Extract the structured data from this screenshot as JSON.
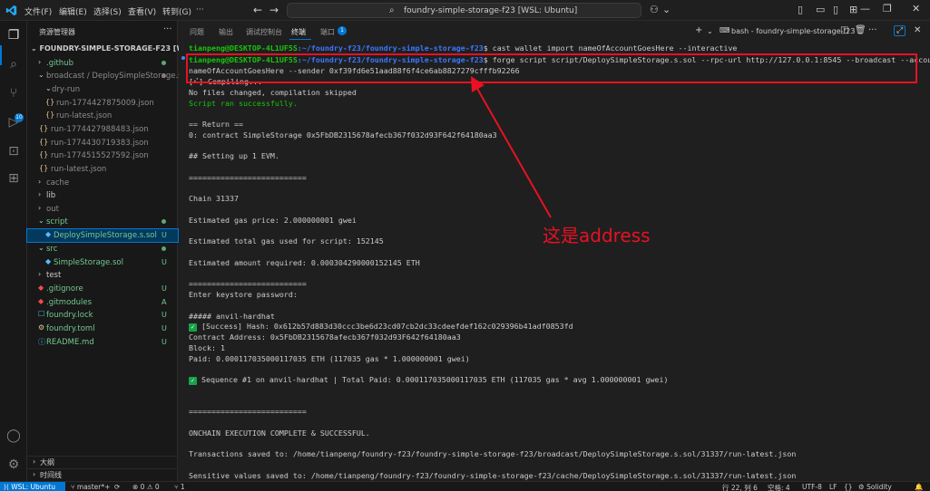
{
  "titlebar": {
    "menu": [
      "文件(F)",
      "编辑(E)",
      "选择(S)",
      "查看(V)",
      "转到(G)"
    ],
    "search_text": "foundry-simple-storage-f23 [WSL: Ubuntu]"
  },
  "sidebar": {
    "header": "资源管理器",
    "root": "FOUNDRY-SIMPLE-STORAGE-F23 [WSL: ...",
    "items": [
      {
        "label": ".github",
        "status": "dot"
      },
      {
        "label": "broadcast / DeploySimpleStorage.s...",
        "status": "dot"
      },
      {
        "label": "dry-run",
        "status": ""
      },
      {
        "label": "run-1774427875009.json",
        "status": ""
      },
      {
        "label": "run-latest.json",
        "status": ""
      },
      {
        "label": "run-1774427988483.json",
        "status": ""
      },
      {
        "label": "run-1774430719383.json",
        "status": ""
      },
      {
        "label": "run-1774515527592.json",
        "status": ""
      },
      {
        "label": "run-latest.json",
        "status": ""
      },
      {
        "label": "cache",
        "status": ""
      },
      {
        "label": "lib",
        "status": ""
      },
      {
        "label": "out",
        "status": ""
      },
      {
        "label": "script",
        "status": "dot"
      },
      {
        "label": "DeploySimpleStorage.s.sol",
        "status": "U"
      },
      {
        "label": "src",
        "status": "dot"
      },
      {
        "label": "SimpleStorage.sol",
        "status": "U"
      },
      {
        "label": "test",
        "status": ""
      },
      {
        "label": ".gitignore",
        "status": "U"
      },
      {
        "label": ".gitmodules",
        "status": "A"
      },
      {
        "label": "foundry.lock",
        "status": "U"
      },
      {
        "label": "foundry.toml",
        "status": "U"
      },
      {
        "label": "README.md",
        "status": "U"
      }
    ],
    "outline": "大纲",
    "timeline": "时间线"
  },
  "panel": {
    "tabs": [
      "问题",
      "输出",
      "调试控制台",
      "终端",
      "端口"
    ],
    "ports_badge": "1",
    "terminal_name": "bash - foundry-simple-storage-f23"
  },
  "terminal": {
    "prompt_user": "tianpeng@DESKTOP-4L1UF5S",
    "prompt_path": ":~/foundry-f23/foundry-simple-storage-f23",
    "cmd1": "$ cast wallet import nameOfAccountGoesHere --interactive",
    "cmd2": "$ forge script script/DeploySimpleStorage.s.sol --rpc-url http://127.0.0.1:8545 --broadcast --account",
    "cmd2_cont": "nameOfAccountGoesHere --sender 0xf39fd6e51aad88f6f4ce6ab8827279cfffb92266",
    "lines": [
      "[⠊] Compiling...",
      "No files changed, compilation skipped",
      "Script ran successfully.",
      "",
      "== Return ==",
      "0: contract SimpleStorage 0x5FbDB2315678afecb367f032d93F642f64180aa3",
      "",
      "## Setting up 1 EVM.",
      "",
      "==========================",
      "",
      "Chain 31337",
      "",
      "Estimated gas price: 2.000000001 gwei",
      "",
      "Estimated total gas used for script: 152145",
      "",
      "Estimated amount required: 0.000304290000152145 ETH",
      "",
      "==========================",
      "Enter keystore password:",
      "",
      "##### anvil-hardhat",
      " [Success] Hash: 0x612b57d883d30ccc3be6d23cd07cb2dc33cdeefdef162c029396b41adf0853fd",
      "Contract Address: 0x5FbDB2315678afecb367f032d93F642f64180aa3",
      "Block: 1",
      "Paid: 0.000117035000117035 ETH (117035 gas * 1.000000001 gwei)",
      "",
      " Sequence #1 on anvil-hardhat | Total Paid: 0.000117035000117035 ETH (117035 gas * avg 1.000000001 gwei)",
      "",
      "",
      "==========================",
      "",
      "ONCHAIN EXECUTION COMPLETE & SUCCESSFUL.",
      "",
      "Transactions saved to: /home/tianpeng/foundry-f23/foundry-simple-storage-f23/broadcast/DeploySimpleStorage.s.sol/31337/run-latest.json",
      "",
      "Sensitive values saved to: /home/tianpeng/foundry-f23/foundry-simple-storage-f23/cache/DeploySimpleStorage.s.sol/31337/run-latest.json"
    ]
  },
  "annotation": {
    "text": "这是address"
  },
  "statusbar": {
    "remote": "WSL: Ubuntu",
    "branch": "master*+",
    "problems": "⊗ 0 ⚠ 0",
    "ports": "1",
    "position": "行 22, 列 6",
    "spaces": "空格: 4",
    "encoding": "UTF-8",
    "eol": "LF",
    "language": "Solidity"
  },
  "colors": {
    "accent": "#0078d4",
    "annotation_red": "#e81123",
    "prompt_green": "#16c60c",
    "prompt_blue": "#3b78ff"
  }
}
